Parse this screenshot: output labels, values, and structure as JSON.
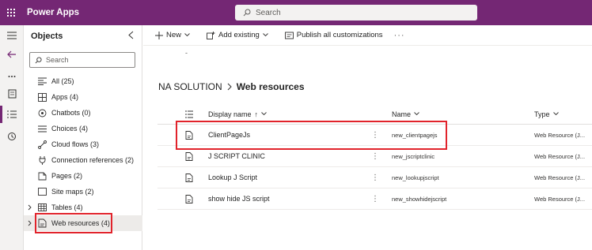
{
  "app": {
    "title": "Power Apps"
  },
  "search": {
    "placeholder": "Search"
  },
  "panel": {
    "title": "Objects",
    "search_placeholder": "Search",
    "items": [
      {
        "label": "All (25)",
        "icon": "list-icon",
        "expandable": false
      },
      {
        "label": "Apps (4)",
        "icon": "apps-icon",
        "expandable": false
      },
      {
        "label": "Chatbots (0)",
        "icon": "chatbot-icon",
        "expandable": false
      },
      {
        "label": "Choices (4)",
        "icon": "choices-icon",
        "expandable": false
      },
      {
        "label": "Cloud flows (3)",
        "icon": "flow-icon",
        "expandable": false
      },
      {
        "label": "Connection references (2)",
        "icon": "connection-icon",
        "expandable": false
      },
      {
        "label": "Pages (2)",
        "icon": "page-icon",
        "expandable": false
      },
      {
        "label": "Site maps (2)",
        "icon": "sitemap-icon",
        "expandable": false
      },
      {
        "label": "Tables (4)",
        "icon": "table-icon",
        "expandable": true
      },
      {
        "label": "Web resources (4)",
        "icon": "web-resource-icon",
        "expandable": true,
        "selected": true
      }
    ]
  },
  "commands": {
    "new": "New",
    "add_existing": "Add existing",
    "publish": "Publish all customizations",
    "more": "···"
  },
  "misc": {
    "dot": "-"
  },
  "breadcrumb": {
    "parent": "NA SOLUTION",
    "current": "Web resources"
  },
  "grid": {
    "headers": {
      "display_name": "Display name",
      "display_name_sort": "↑",
      "name": "Name",
      "type": "Type"
    },
    "rows": [
      {
        "display_name": "ClientPageJs",
        "name": "new_clientpagejs",
        "type": "Web Resource (J..."
      },
      {
        "display_name": "J SCRIPT CLINIC",
        "name": "new_jscriptclinic",
        "type": "Web Resource (J..."
      },
      {
        "display_name": "Lookup J Script",
        "name": "new_lookupjscript",
        "type": "Web Resource (J..."
      },
      {
        "display_name": "show hide JS script",
        "name": "new_showhidejscript",
        "type": "Web Resource (J..."
      }
    ]
  },
  "colors": {
    "brand": "#742774",
    "highlight": "#e1232b"
  }
}
